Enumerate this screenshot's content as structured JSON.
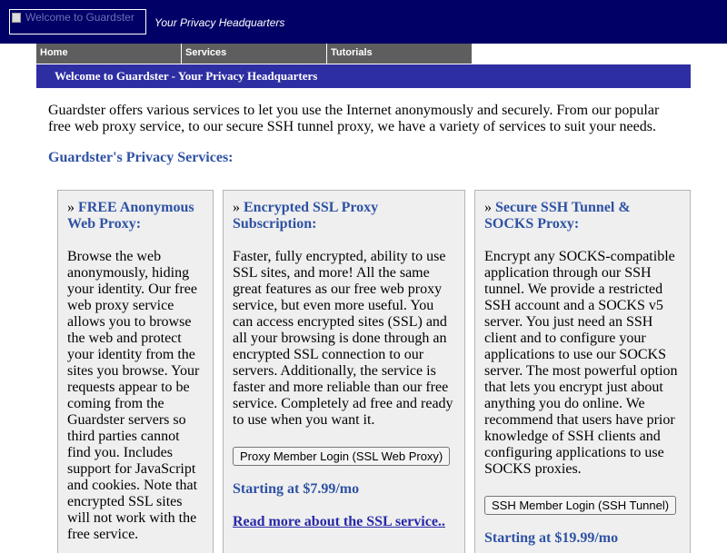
{
  "header": {
    "logo_alt": "Welcome to Guardster",
    "tagline": "Your Privacy Headquarters"
  },
  "nav": {
    "items": [
      {
        "label": "Home"
      },
      {
        "label": "Services"
      },
      {
        "label": "Tutorials"
      }
    ]
  },
  "welcome_bar": {
    "text": "Welcome to Guardster - Your Privacy Headquarters"
  },
  "intro": {
    "text": "Guardster offers various services to let you use the Internet anonymously and securely. From our popular free web proxy service, to our secure SSH tunnel proxy, we have a variety of services to suit your needs."
  },
  "services_heading": "Guardster's Privacy Services:",
  "colors": {
    "header_bg": "#000066",
    "nav_bg": "#5e5e5e",
    "welcome_bg": "#2e2ea3",
    "accent_text": "#2e52a4",
    "link": "#2828a8",
    "box_bg": "#efefef"
  },
  "services": [
    {
      "title_prefix": "»",
      "title": "FREE Anonymous Web Proxy:",
      "description": "Browse the web anonymously, hiding your identity. Our free web proxy service allows you to browse the web and protect your identity from the sites you browse. Your requests appear to be coming from the Guardster servers so third parties cannot find you. Includes support for JavaScript and cookies. Note that encrypted SSL sites will not work with the free service."
    },
    {
      "title_prefix": "»",
      "title": "Encrypted SSL Proxy Subscription:",
      "description": "Faster, fully encrypted, ability to use SSL sites, and more! All the same great features as our free web proxy service, but even more useful. You can access encrypted sites (SSL) and all your browsing is done through an encrypted SSL connection to our servers. Additionally, the service is faster and more reliable than our free service. Completely ad free and ready to use when you want it.",
      "button": "Proxy Member Login (SSL Web Proxy)",
      "price": "Starting at $7.99/mo",
      "link": "Read more about the SSL service.."
    },
    {
      "title_prefix": "»",
      "title": "Secure SSH Tunnel & SOCKS Proxy:",
      "description": "Encrypt any SOCKS-compatible application through our SSH tunnel. We provide a restricted SSH account and a SOCKS v5 server. You just need an SSH client and to configure your applications to use our SOCKS server. The most powerful option that lets you encrypt just about anything you do online. We recommend that users have prior knowledge of SSH clients and configuring applications to use SOCKS proxies.",
      "button": "SSH Member Login (SSH Tunnel)",
      "price": "Starting at $19.99/mo"
    }
  ]
}
